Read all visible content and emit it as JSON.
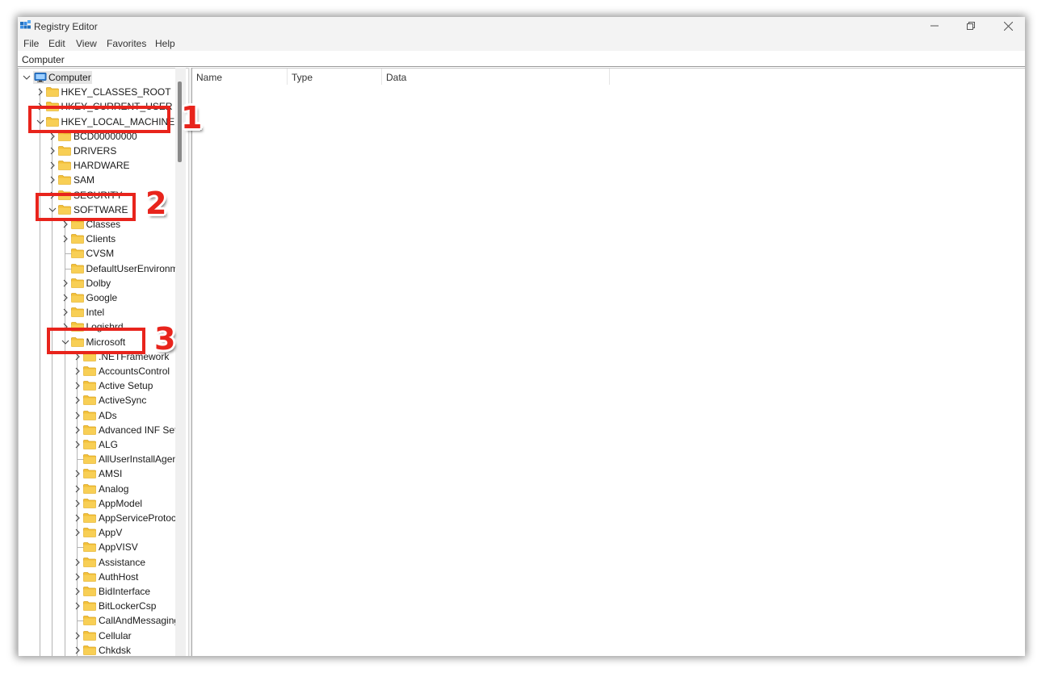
{
  "window": {
    "title": "Registry Editor"
  },
  "menu": [
    "File",
    "Edit",
    "View",
    "Favorites",
    "Help"
  ],
  "address": "Computer",
  "tree": {
    "root": "Computer",
    "hives": [
      "HKEY_CLASSES_ROOT",
      "HKEY_CURRENT_USER",
      "HKEY_LOCAL_MACHINE"
    ],
    "hklm_children": [
      "BCD00000000",
      "DRIVERS",
      "HARDWARE",
      "SAM",
      "SECURITY",
      "SOFTWARE"
    ],
    "software_children": [
      "Classes",
      "Clients",
      "CVSM",
      "DefaultUserEnvironm",
      "Dolby",
      "Google",
      "Intel",
      "Logishrd",
      "Microsoft"
    ],
    "microsoft_children": [
      ".NETFramework",
      "AccountsControl",
      "Active Setup",
      "ActiveSync",
      "ADs",
      "Advanced INF Set",
      "ALG",
      "AllUserInstallAgen",
      "AMSI",
      "Analog",
      "AppModel",
      "AppServiceProtoc",
      "AppV",
      "AppVISV",
      "Assistance",
      "AuthHost",
      "BidInterface",
      "BitLockerCsp",
      "CallAndMessaging",
      "Cellular",
      "Chkdsk"
    ]
  },
  "list": {
    "columns": [
      "Name",
      "Type",
      "Data"
    ]
  },
  "annotations": [
    "1",
    "2",
    "3"
  ],
  "colors": {
    "annotation": "#e8241c",
    "folder": "#f3c13a",
    "selection": "#e5e5e5"
  }
}
